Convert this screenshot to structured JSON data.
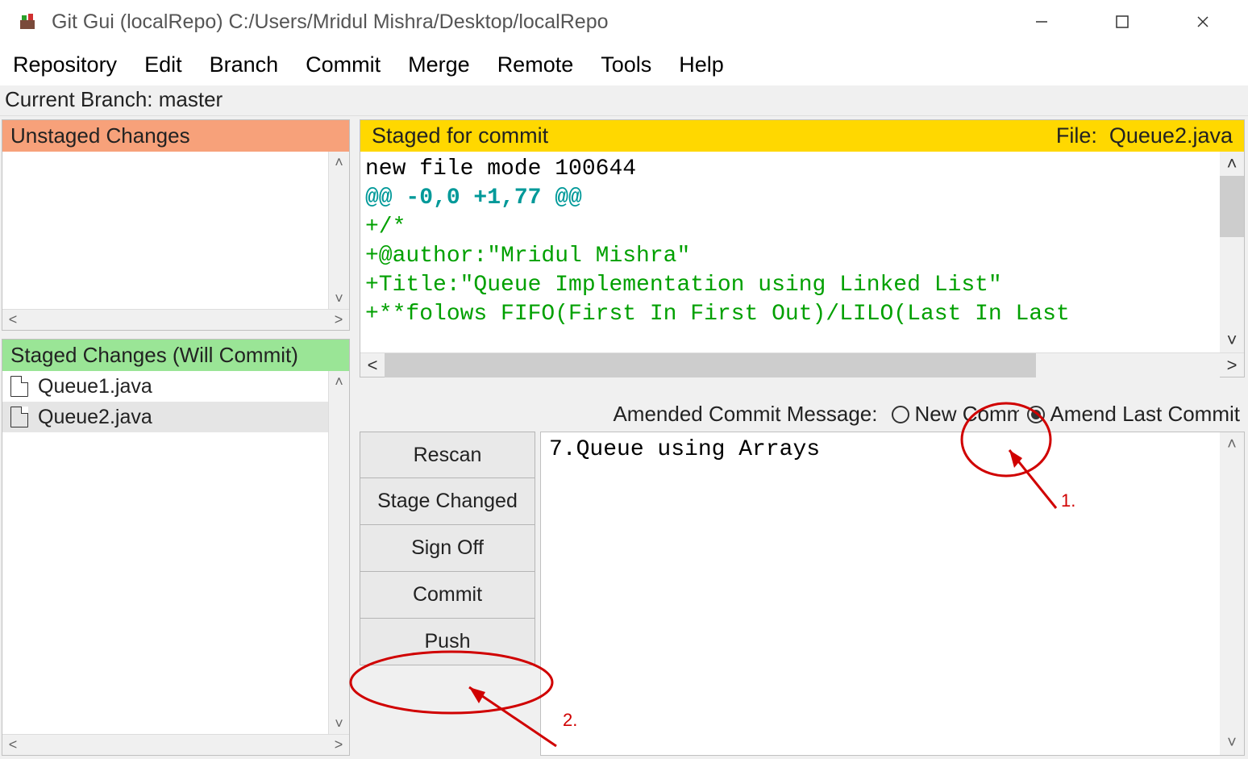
{
  "window": {
    "title": "Git Gui (localRepo) C:/Users/Mridul Mishra/Desktop/localRepo"
  },
  "menu": {
    "items": [
      "Repository",
      "Edit",
      "Branch",
      "Commit",
      "Merge",
      "Remote",
      "Tools",
      "Help"
    ]
  },
  "status": {
    "branch_label": "Current Branch: master"
  },
  "unstaged": {
    "header": "Unstaged Changes"
  },
  "staged": {
    "header": "Staged Changes (Will Commit)",
    "files": [
      "Queue1.java",
      "Queue2.java"
    ],
    "selected_index": 1
  },
  "diff": {
    "header_left": "Staged for commit",
    "header_right_label": "File:",
    "header_right_file": "Queue2.java",
    "lines": [
      {
        "cls": "meta",
        "text": "new file mode 100644"
      },
      {
        "cls": "hunk",
        "text": "@@ -0,0 +1,77 @@"
      },
      {
        "cls": "add",
        "text": "+/*"
      },
      {
        "cls": "add",
        "text": "+@author:\"Mridul Mishra\""
      },
      {
        "cls": "add",
        "text": "+Title:\"Queue Implementation using Linked List\""
      },
      {
        "cls": "add",
        "text": "+**folows FIFO(First In First Out)/LILO(Last In Last"
      }
    ]
  },
  "commit": {
    "label": "Amended Commit Message:",
    "opt_new": "New Commit",
    "opt_amend": "Amend Last Commit",
    "selected": "amend",
    "message": "7.Queue using Arrays",
    "buttons": [
      "Rescan",
      "Stage Changed",
      "Sign Off",
      "Commit",
      "Push"
    ]
  },
  "annotations": {
    "one": "1.",
    "two": "2."
  }
}
